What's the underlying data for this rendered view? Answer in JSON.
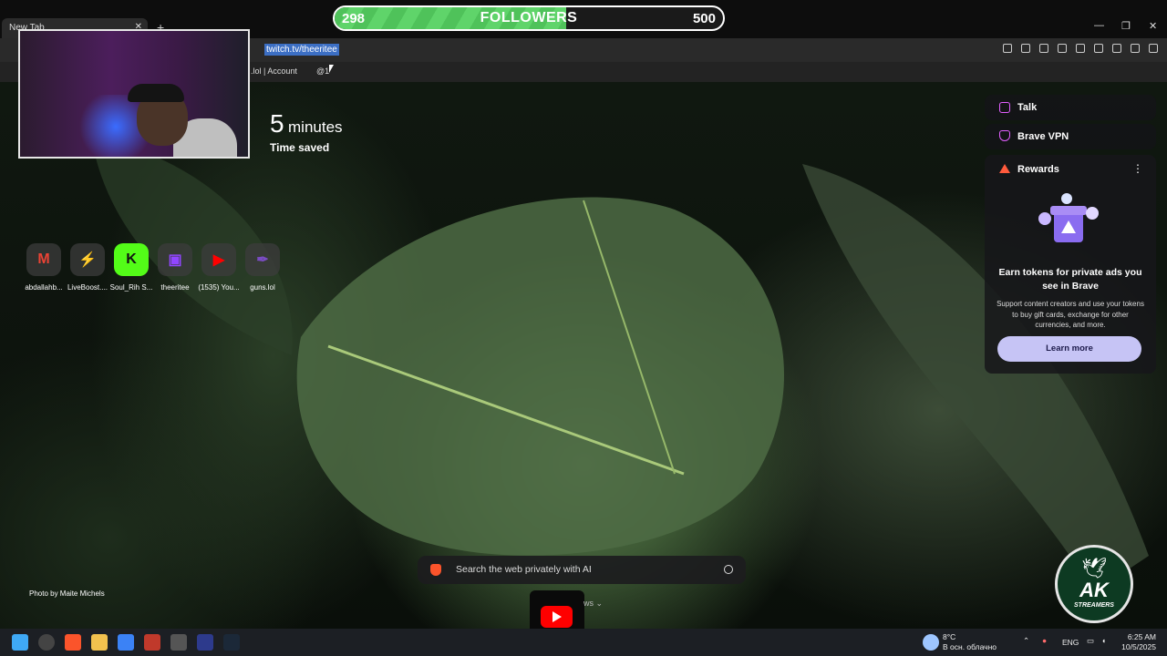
{
  "overlay": {
    "followers_current": "298",
    "followers_goal": "500",
    "followers_label": "FOLLOWERS",
    "followers_progress": 0.596
  },
  "browser": {
    "tab_title": "New Tab",
    "address": "twitch.tv/theeritee",
    "bookmarks": [
      ".lol | Account",
      "@1"
    ]
  },
  "newtab": {
    "stat_value": "5",
    "stat_unit": "minutes",
    "stat_label": "Time saved",
    "top_sites": [
      {
        "name": "abdallahb...",
        "icon": "gmail-icon",
        "color": "#ea4335"
      },
      {
        "name": "LiveBoost....",
        "icon": "bolt-icon",
        "color": "#1a1a1a"
      },
      {
        "name": "Soul_Rih S...",
        "icon": "kick-icon",
        "color": "#53fc18"
      },
      {
        "name": "theeritee",
        "icon": "twitch-icon",
        "color": "#9146ff"
      },
      {
        "name": "(1535) You...",
        "icon": "youtube-icon",
        "color": "#ff0000"
      },
      {
        "name": "guns.lol",
        "icon": "pen-icon",
        "color": "#7a4cc2"
      }
    ],
    "photo_credit": "Photo by Maite Michels",
    "search_placeholder": "Search the web privately with AI",
    "news_label": "ws"
  },
  "panel": {
    "talk": "Talk",
    "vpn": "Brave VPN",
    "rewards_title": "Rewards",
    "rewards_heading": "Earn tokens for private ads you see in Brave",
    "rewards_body": "Support content creators and use your tokens to buy gift cards, exchange for other currencies, and more.",
    "rewards_button": "Learn more"
  },
  "logo": {
    "main": "AK",
    "sub": "STREAMERS"
  },
  "taskbar": {
    "temperature": "8°C",
    "weather": "В осн. облачно",
    "language": "ENG",
    "time": "6:25 AM",
    "date": "10/5/2025"
  }
}
